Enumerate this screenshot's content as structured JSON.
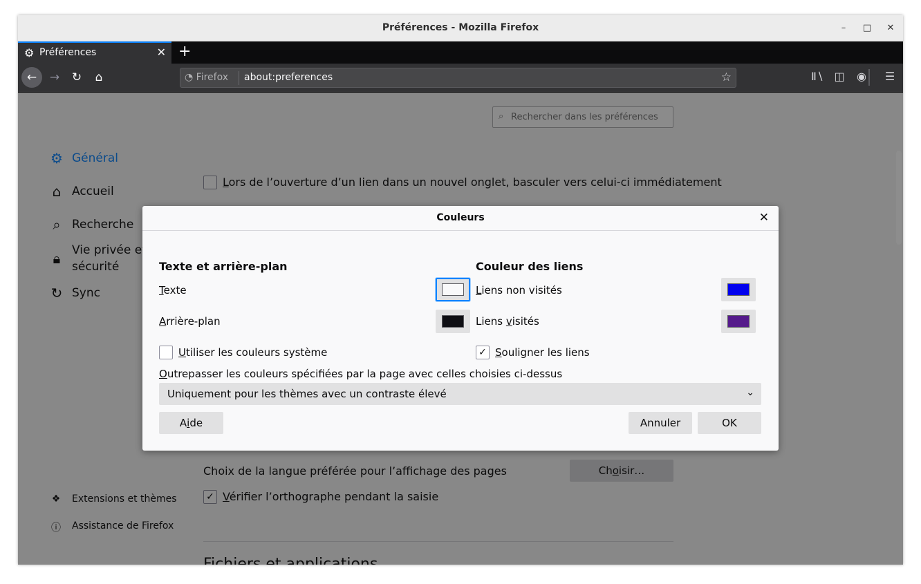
{
  "window": {
    "title": "Préférences - Mozilla Firefox"
  },
  "tabs": [
    {
      "label": "Préférences",
      "icon": "gear-icon"
    }
  ],
  "navbar": {
    "identity": "Firefox",
    "url": "about:preferences"
  },
  "search": {
    "placeholder": "Rechercher dans les préférences"
  },
  "sidebar": {
    "categories": [
      {
        "label": "Général",
        "icon": "gear-icon",
        "active": true
      },
      {
        "label": "Accueil",
        "icon": "home-icon"
      },
      {
        "label": "Recherche",
        "icon": "search-icon"
      },
      {
        "label": "Vie privée et sécurité",
        "label_line1": "Vie privée et",
        "label_line2": "sécurité",
        "icon": "lock-icon"
      },
      {
        "label": "Sync",
        "icon": "sync-icon"
      }
    ],
    "footer": [
      {
        "label": "Extensions et thèmes",
        "icon": "puzzle-icon"
      },
      {
        "label": "Assistance de Firefox",
        "icon": "help-icon"
      }
    ]
  },
  "background": {
    "switch_tab_option": {
      "u": "L",
      "rest": "ors de l’ouverture d’un lien dans un nouvel onglet, basculer vers celui-ci immédiatement",
      "checked": false
    },
    "language_label": "Choix de la langue préférée pour l’affichage des pages",
    "choose_button": {
      "pre": "Ch",
      "u": "o",
      "post": "isir…"
    },
    "spellcheck": {
      "u": "V",
      "rest": "érifier l’orthographe pendant la saisie",
      "checked": true
    },
    "section_title": "Fichiers et applications"
  },
  "dialog": {
    "title": "Couleurs",
    "text_bg_heading": "Texte et arrière-plan",
    "links_heading": "Couleur des liens",
    "text_label": {
      "u": "T",
      "rest": "exte"
    },
    "background_label": {
      "u": "A",
      "rest": "rrière-plan"
    },
    "unvisited_label": {
      "u": "L",
      "rest": "iens non visités"
    },
    "visited_label": {
      "pre": "Liens ",
      "u": "v",
      "rest": "isités"
    },
    "system_colors": {
      "u": "U",
      "rest": "tiliser les couleurs système",
      "checked": false
    },
    "underline_links": {
      "u": "S",
      "rest": "ouligner les liens",
      "checked": true
    },
    "override_label": {
      "u": "O",
      "rest": "utrepasser les couleurs spécifiées par la page avec celles choisies ci-dessus"
    },
    "override_value": "Uniquement pour les thèmes avec un contraste élevé",
    "help_button": {
      "pre": "A",
      "u": "i",
      "post": "de"
    },
    "cancel_button": "Annuler",
    "ok_button": "OK",
    "colors": {
      "text": "#f9f9fa",
      "background": "#0f0f14",
      "unvisited": "#0000ee",
      "visited": "#551a8b"
    }
  },
  "theme": {
    "accent": "#0a84ff",
    "toolbar": "#323234",
    "tabstrip": "#0c0c0d"
  }
}
